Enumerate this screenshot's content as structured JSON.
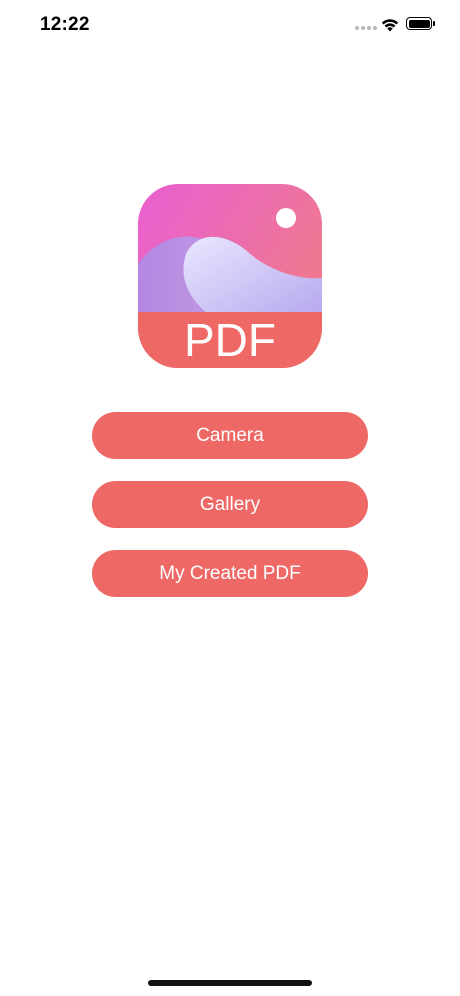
{
  "status_bar": {
    "time": "12:22",
    "icons": [
      "signal-dots-icon",
      "wifi-icon",
      "battery-icon"
    ]
  },
  "logo": {
    "text": "PDF",
    "colors": {
      "band": "#ee6866",
      "top_left": "#e85fd3",
      "top_right": "#f07a8a",
      "wave_light": "#e9e8ff",
      "wave_dark": "#b7a8ee"
    }
  },
  "menu": {
    "buttons": [
      {
        "label": "Camera"
      },
      {
        "label": "Gallery"
      },
      {
        "label": "My Created PDF"
      }
    ],
    "button_color": "#ee6866"
  }
}
